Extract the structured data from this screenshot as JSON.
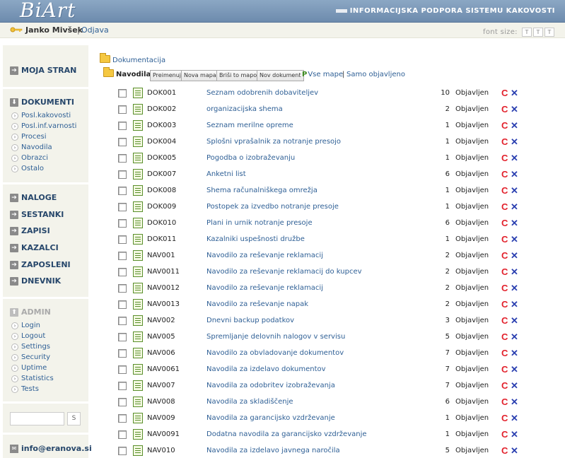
{
  "header": {
    "logo": "BiArt",
    "tagline": "INFORMACIJSKA PODPORA SISTEMU KAKOVOSTI"
  },
  "userbar": {
    "user_name": "Janko Mivšek",
    "separator": "|",
    "logout": "Odjava",
    "font_size_label": "font size:",
    "font_buttons": [
      "T",
      "T",
      "T"
    ]
  },
  "sidebar": {
    "moja_stran": "MOJA STRAN",
    "dokumenti": "DOKUMENTI",
    "dokumenti_items": [
      "Posl.kakovosti",
      "Posl.inf.varnosti",
      "Procesi",
      "Navodila",
      "Obrazci",
      "Ostalo"
    ],
    "sections": [
      "NALOGE",
      "SESTANKI",
      "ZAPISI",
      "KAZALCI",
      "ZAPOSLENI",
      "DNEVNIK"
    ],
    "admin": "ADMIN",
    "admin_items": [
      "Login",
      "Logout",
      "Settings",
      "Security",
      "Uptime",
      "Statistics",
      "Tests"
    ],
    "search_placeholder": "",
    "search_button": "S",
    "email": "info@eranova.si"
  },
  "main": {
    "breadcrumb": "Dokumentacija",
    "current_folder": "Navodila",
    "toolbar": [
      "Preimenuj",
      "Nova mapa",
      "Briši to mapo",
      "Nov dokument"
    ],
    "vse_mape": "Vse mape",
    "link_sep": "|",
    "samo_objavljeno": "Samo objavljeno",
    "documents": [
      {
        "code": "DOK001",
        "title": "Seznam odobrenih dobaviteljev",
        "version": "10",
        "status": "Objavljen"
      },
      {
        "code": "DOK002",
        "title": "organizacijska shema",
        "version": "2",
        "status": "Objavljen"
      },
      {
        "code": "DOK003",
        "title": "Seznam merilne opreme",
        "version": "1",
        "status": "Objavljen"
      },
      {
        "code": "DOK004",
        "title": "Splošni vprašalnik za notranje presojo",
        "version": "1",
        "status": "Objavljen"
      },
      {
        "code": "DOK005",
        "title": "Pogodba o izobraževanju",
        "version": "1",
        "status": "Objavljen"
      },
      {
        "code": "DOK007",
        "title": "Anketni list",
        "version": "6",
        "status": "Objavljen"
      },
      {
        "code": "DOK008",
        "title": "Shema računalniškega omrežja",
        "version": "1",
        "status": "Objavljen"
      },
      {
        "code": "DOK009",
        "title": "Postopek za izvedbo notranje presoje",
        "version": "1",
        "status": "Objavljen"
      },
      {
        "code": "DOK010",
        "title": "Plani in urnik notranje presoje",
        "version": "6",
        "status": "Objavljen"
      },
      {
        "code": "DOK011",
        "title": "Kazalniki uspešnosti družbe",
        "version": "1",
        "status": "Objavljen"
      },
      {
        "code": "NAV001",
        "title": "Navodilo za reševanje reklamacij",
        "version": "2",
        "status": "Objavljen"
      },
      {
        "code": "NAV0011",
        "title": "Navodilo za reševanje reklamacij do kupcev",
        "version": "2",
        "status": "Objavljen"
      },
      {
        "code": "NAV0012",
        "title": "Navodilo za reševanje reklamacij",
        "version": "2",
        "status": "Objavljen"
      },
      {
        "code": "NAV0013",
        "title": "Navodilo za reševanje napak",
        "version": "2",
        "status": "Objavljen"
      },
      {
        "code": "NAV002",
        "title": "Dnevni backup podatkov",
        "version": "3",
        "status": "Objavljen"
      },
      {
        "code": "NAV005",
        "title": "Spremljanje delovnih nalogov v servisu",
        "version": "5",
        "status": "Objavljen"
      },
      {
        "code": "NAV006",
        "title": "Navodilo za obvladovanje dokumentov",
        "version": "7",
        "status": "Objavljen"
      },
      {
        "code": "NAV0061",
        "title": "Navodila za izdelavo dokumentov",
        "version": "7",
        "status": "Objavljen"
      },
      {
        "code": "NAV007",
        "title": "Navodila za odobritev izobraževanja",
        "version": "7",
        "status": "Objavljen"
      },
      {
        "code": "NAV008",
        "title": "Navodila za skladiščenje",
        "version": "6",
        "status": "Objavljen"
      },
      {
        "code": "NAV009",
        "title": "Navodila za garancijsko vzdrževanje",
        "version": "1",
        "status": "Objavljen"
      },
      {
        "code": "NAV0091",
        "title": "Dodatna navodila za garancijsko vzdrževanje",
        "version": "1",
        "status": "Objavljen"
      },
      {
        "code": "NAV010",
        "title": "Navodila za izdelavo javnega naročila",
        "version": "5",
        "status": "Objavljen"
      }
    ]
  },
  "colors": {
    "header": "#7a97b8",
    "sidebar_bg": "#f3f3eb",
    "link": "#2e5f95",
    "copy_icon": "#e2202b",
    "delete_icon": "#2a3fb0"
  },
  "icons": {
    "user": "key-icon",
    "folder": "folder-icon",
    "document": "document-icon",
    "copy": "copy-c-icon",
    "delete": "delete-x-icon"
  }
}
